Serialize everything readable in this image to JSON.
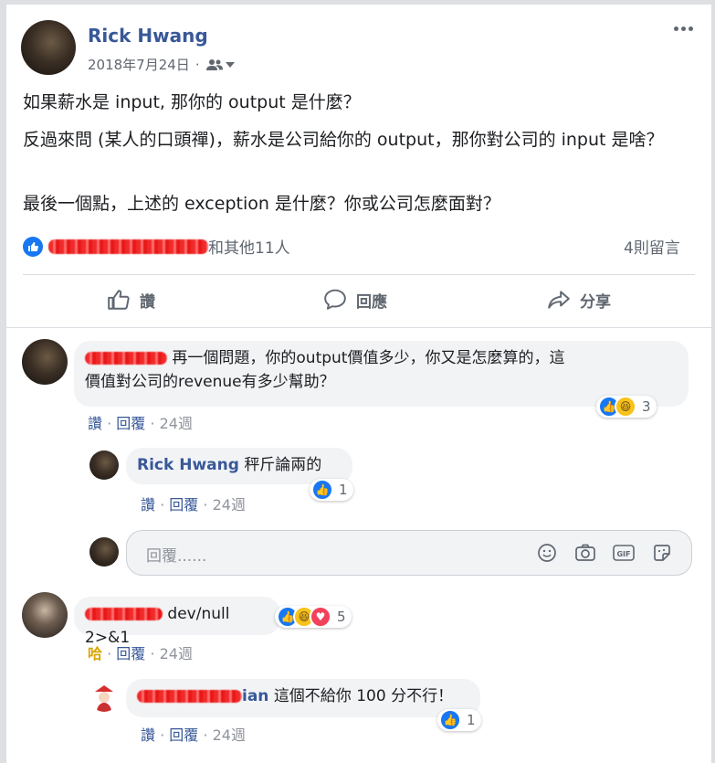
{
  "post": {
    "author": "Rick Hwang",
    "date": "2018年7月24日",
    "meta_sep": "·",
    "audience_icon": "friends-icon",
    "more_icon": "ellipsis-icon",
    "paragraphs": [
      "如果薪水是 input, 那你的 output 是什麼？",
      "反過來問 (某人的口頭禪)，薪水是公司給你的 output，那你對公司的 input 是啥？",
      "最後一個點，上述的 exception 是什麼？你或公司怎麼面對？"
    ],
    "reactions_text": "和其他11人",
    "comment_count": "4則留言",
    "actions": {
      "like": "讚",
      "comment": "回應",
      "share": "分享"
    }
  },
  "comments": [
    {
      "text": "再一個問題，你的output價值多少，你又是怎麼算的，這價值對公司的revenue有多少幫助？",
      "line1": "再一個問題，你的output價值多少，你又是怎麼算的，這",
      "line2": "價值對公司的revenue有多少幫助？",
      "links": {
        "like": "讚",
        "reply": "回覆",
        "time": "24週"
      },
      "reaction_count": "3",
      "replies": [
        {
          "author": "Rick Hwang",
          "text": "秤斤論兩的",
          "links": {
            "like": "讚",
            "reply": "回覆",
            "time": "24週"
          },
          "reaction_count": "1"
        }
      ]
    },
    {
      "text_visible": "dev/null 2>&1",
      "links": {
        "like": "哈",
        "reply": "回覆",
        "time": "24週"
      },
      "reaction_count": "5",
      "replies": [
        {
          "author_suffix": "ian",
          "text": "這個不給你 100 分不行！",
          "links": {
            "like": "讚",
            "reply": "回覆",
            "time": "24週"
          },
          "reaction_count": "1"
        }
      ]
    }
  ],
  "reply_input": {
    "placeholder": "回覆......"
  },
  "sep": "·",
  "colors": {
    "link": "#385898",
    "like_blue": "#1877f2",
    "redaction": "#f02a2a"
  }
}
